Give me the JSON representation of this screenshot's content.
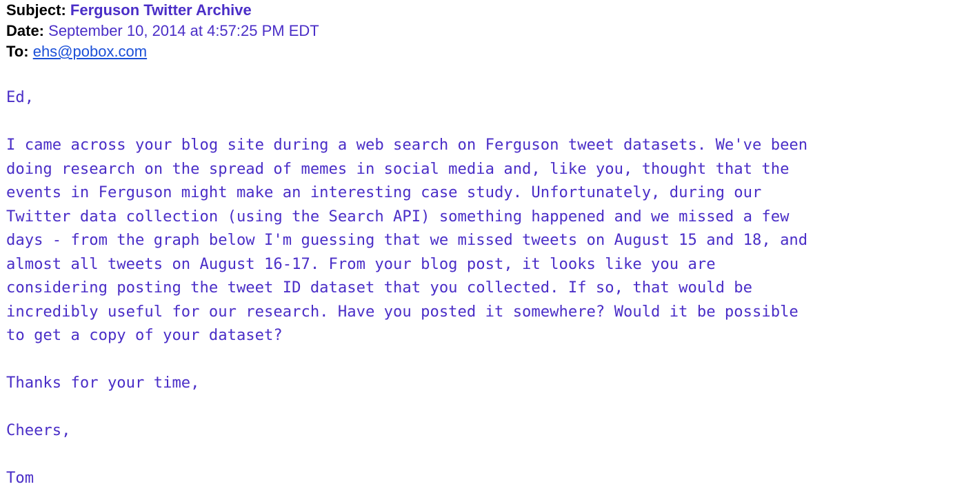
{
  "headers": {
    "subject_label": "Subject:",
    "subject": "Ferguson Twitter Archive",
    "date_label": "Date:",
    "date": "September 10, 2014 at 4:57:25 PM EDT",
    "to_label": "To:",
    "to": "ehs@pobox.com"
  },
  "body": {
    "greeting": "Ed,",
    "paragraph_lines": [
      "I came across your blog site during a web search on Ferguson tweet datasets. We've been",
      "doing research on the spread of memes in social media and, like you, thought that the",
      "events in Ferguson might make an interesting case study. Unfortunately, during our",
      "Twitter data collection (using the Search API) something happened and we missed a few",
      "days - from the graph below I'm guessing that we missed tweets on August 15 and 18, and",
      "almost all tweets on August 16-17. From your blog post, it looks like you are",
      "considering posting the tweet ID dataset that you collected. If so, that would be",
      "incredibly useful for our research. Have you posted it somewhere? Would it be possible",
      "to get a copy of your dataset?"
    ],
    "thanks": "Thanks for your time,",
    "closing": "Cheers,",
    "signature": "Tom"
  },
  "colors": {
    "text": "#4a2ec7",
    "label": "#000000",
    "link": "#1a4fd8"
  }
}
